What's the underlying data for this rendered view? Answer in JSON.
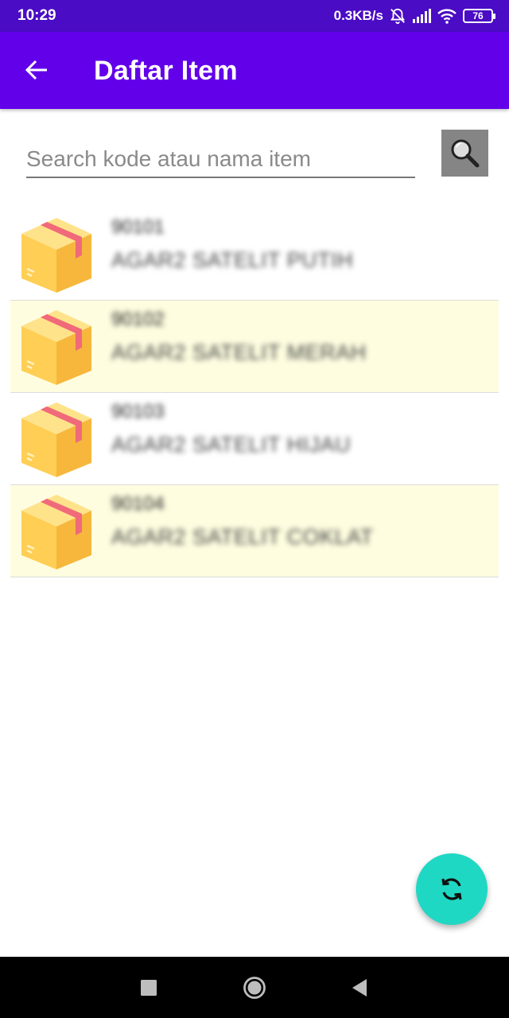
{
  "status_bar": {
    "time": "10:29",
    "network_speed": "0.3KB/s",
    "battery_level": "76",
    "icons": [
      "mute-icon",
      "signal-icon",
      "wifi-icon",
      "battery-icon"
    ]
  },
  "app_bar": {
    "title": "Daftar Item",
    "back_icon": "arrow-left-icon",
    "background_color": "#6200ea"
  },
  "search": {
    "placeholder": "Search kode atau nama item",
    "value": "",
    "button_icon": "search-icon"
  },
  "items": [
    {
      "code": "90101",
      "name": "AGAR2 SATELIT PUTIH",
      "icon": "box-icon"
    },
    {
      "code": "90102",
      "name": "AGAR2 SATELIT MERAH",
      "icon": "box-icon"
    },
    {
      "code": "90103",
      "name": "AGAR2 SATELIT HIJAU",
      "icon": "box-icon"
    },
    {
      "code": "90104",
      "name": "AGAR2 SATELIT COKLAT",
      "icon": "box-icon"
    }
  ],
  "fab": {
    "icon": "refresh-icon",
    "color": "#1fd8c3"
  },
  "nav_bar": {
    "buttons": [
      "recents-icon",
      "home-icon",
      "back-icon"
    ]
  }
}
